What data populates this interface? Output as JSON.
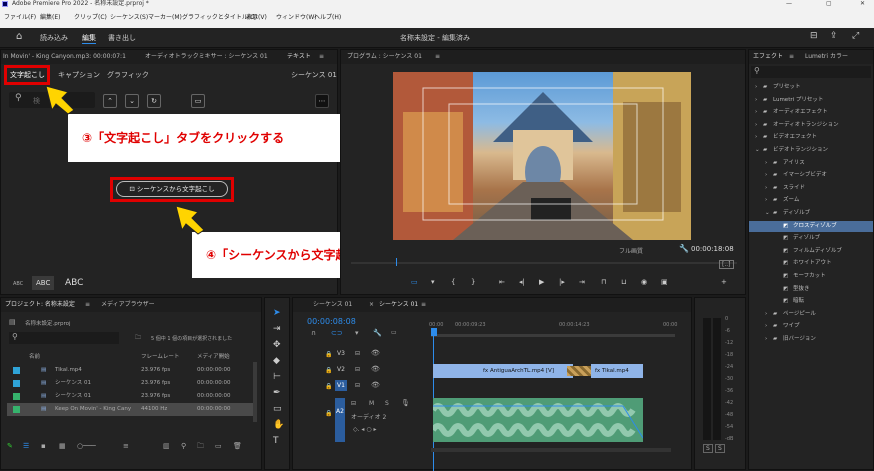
{
  "titlebar": {
    "text": "Adobe Premiere Pro 2022 - 名称未設定.prproj *"
  },
  "menu": [
    "ファイル(F)",
    "編集(E)",
    "クリップ(C)",
    "シーケンス(S)",
    "マーカー(M)",
    "グラフィックとタイトル(G)",
    "表示(V)",
    "ウィンドウ(W)",
    "ヘルプ(H)"
  ],
  "workspace": {
    "tabs": [
      "読み込み",
      "編集",
      "書き出し"
    ],
    "center": "名称未設定 - 編集済み"
  },
  "top_left_panel": {
    "head_left": "In Movin' - King Canyon.mp3: 00:00:07:1",
    "head_mid": "オーディオトラックミキサー : シーケンス 01",
    "head_right": "テキスト",
    "tabs": [
      "文字起こし",
      "キャプション",
      "グラフィック"
    ],
    "sequence_label": "シーケンス 01",
    "search_placeholder": "検",
    "transcribe_button": "シーケンスから文字起こし",
    "abc": [
      "ABC",
      "ABC",
      "ABC"
    ]
  },
  "callouts": {
    "c3": "③「文字起こし」タブをクリックする",
    "c4": "④「シーケンスから文字起こし」をクリックする"
  },
  "program": {
    "head": "プログラム : シーケンス 01",
    "quality": "フル画質",
    "timecode": "00:00:18:08"
  },
  "project": {
    "head": "プロジェクト: 名称未設定",
    "head2": "メディアブラウザー",
    "file": "名称未設定.prproj",
    "info": "5 個中 1 個の項目が選択されました",
    "columns": [
      "名前",
      "フレームレート",
      "メディア開始"
    ],
    "rows": [
      {
        "name": "Tikal.mp4",
        "rate": "23.976 fps",
        "start": "00:00:00:00",
        "color": "#2fa3d7"
      },
      {
        "name": "シーケンス 01",
        "rate": "23.976 fps",
        "start": "00:00:00:00",
        "color": "#2fa3d7"
      },
      {
        "name": "シーケンス 01",
        "rate": "23.976 fps",
        "start": "00:00:00:00",
        "color": "#36b36d"
      },
      {
        "name": "Keep On Movin' - King Cany",
        "rate": "44100 Hz",
        "start": "00:00:00:00",
        "color": "#36b36d"
      }
    ]
  },
  "timeline": {
    "tabs": [
      "シーケンス 01",
      "シーケンス 01"
    ],
    "timecode": "00:00:08:08",
    "ruler": [
      "00:00",
      "00:00:09:23",
      "00:00:14:23",
      "00:00"
    ],
    "tracks": [
      "V3",
      "V2",
      "V1",
      "A2"
    ],
    "audio_name": "オーディオ 2",
    "clips": {
      "v2a": "AntiguaArchTL.mp4 [V]",
      "v2b": "Tikal.mp4"
    }
  },
  "effects": {
    "head": "エフェクト",
    "head2": "Lumetri カラー",
    "items": [
      {
        "label": "プリセット",
        "level": 0,
        "open": false
      },
      {
        "label": "Lumetri プリセット",
        "level": 0,
        "open": false
      },
      {
        "label": "オーディオエフェクト",
        "level": 0,
        "open": false
      },
      {
        "label": "オーディオトランジション",
        "level": 0,
        "open": false
      },
      {
        "label": "ビデオエフェクト",
        "level": 0,
        "open": false
      },
      {
        "label": "ビデオトランジション",
        "level": 0,
        "open": true
      },
      {
        "label": "アイリス",
        "level": 1,
        "open": false
      },
      {
        "label": "イマーシブビデオ",
        "level": 1,
        "open": false
      },
      {
        "label": "スライド",
        "level": 1,
        "open": false
      },
      {
        "label": "ズーム",
        "level": 1,
        "open": false
      },
      {
        "label": "ディゾルブ",
        "level": 1,
        "open": true
      },
      {
        "label": "クロスディゾルブ",
        "level": 2,
        "open": false
      },
      {
        "label": "ディゾルブ",
        "level": 2,
        "open": false
      },
      {
        "label": "フィルムディゾルブ",
        "level": 2,
        "open": false
      },
      {
        "label": "ホワイトアウト",
        "level": 2,
        "open": false
      },
      {
        "label": "モーフカット",
        "level": 2,
        "open": false
      },
      {
        "label": "型抜き",
        "level": 2,
        "open": false
      },
      {
        "label": "暗転",
        "level": 2,
        "open": false
      },
      {
        "label": "ページピール",
        "level": 1,
        "open": false
      },
      {
        "label": "ワイプ",
        "level": 1,
        "open": false
      },
      {
        "label": "旧バージョン",
        "level": 1,
        "open": false
      }
    ]
  },
  "meter": {
    "ticks": [
      "0",
      "-6",
      "-12",
      "-18",
      "-24",
      "-30",
      "-36",
      "-42",
      "-48",
      "-54",
      "-dB"
    ],
    "solo": [
      "S",
      "S"
    ]
  }
}
